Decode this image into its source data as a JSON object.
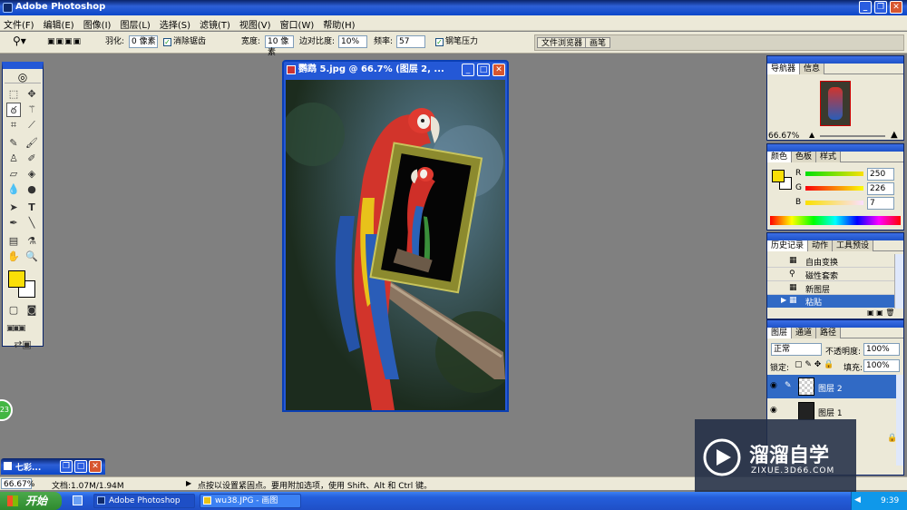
{
  "app": {
    "title": "Adobe Photoshop"
  },
  "menu": [
    "文件(F)",
    "编辑(E)",
    "图像(I)",
    "图层(L)",
    "选择(S)",
    "滤镜(T)",
    "视图(V)",
    "窗口(W)",
    "帮助(H)"
  ],
  "options": {
    "feather_label": "羽化:",
    "feather_value": "0 像素",
    "antialias_label": "消除锯齿",
    "width_label": "宽度:",
    "width_value": "10 像素",
    "edge_contrast_label": "边对比度:",
    "edge_contrast_value": "10%",
    "frequency_label": "频率:",
    "frequency_value": "57",
    "pen_pressure_label": "钢笔压力",
    "file_browser_tab": "文件浏览器",
    "brushes_tab": "画笔"
  },
  "document": {
    "title": "鹦鹉 5.jpg @ 66.7% (图层 2, ..."
  },
  "minimized_doc": {
    "title": "七彩..."
  },
  "navigator": {
    "tabs": [
      "导航器",
      "信息"
    ],
    "zoom": "66.67%"
  },
  "color": {
    "tabs": [
      "颜色",
      "色板",
      "样式"
    ],
    "r_label": "R",
    "r_value": "250",
    "g_label": "G",
    "g_value": "226",
    "b_label": "B",
    "b_value": "7",
    "fg": "#fadf07"
  },
  "history": {
    "tabs": [
      "历史记录",
      "动作",
      "工具预设"
    ],
    "items": [
      "自由变换",
      "磁性套索",
      "新图层",
      "粘贴"
    ]
  },
  "layers": {
    "tabs": [
      "图层",
      "通道",
      "路径"
    ],
    "mode": "正常",
    "opacity_label": "不透明度:",
    "opacity_value": "100%",
    "lock_label": "锁定:",
    "fill_label": "填充:",
    "fill_value": "100%",
    "items": [
      "图层 2",
      "图层 1"
    ]
  },
  "status": {
    "zoom": "66.67%",
    "doc": "文档:1.07M/1.94M",
    "hint": "点按以设置紧固点。要用附加选项，使用 Shift、Alt 和 Ctrl 键。"
  },
  "taskbar": {
    "start": "开始",
    "items": [
      "Adobe Photoshop",
      "wu38.JPG - 画图"
    ],
    "clock": "9:39"
  },
  "badge": {
    "value": "23"
  },
  "watermark": {
    "title": "溜溜自学",
    "url": "ZIXUE.3D66.COM"
  }
}
